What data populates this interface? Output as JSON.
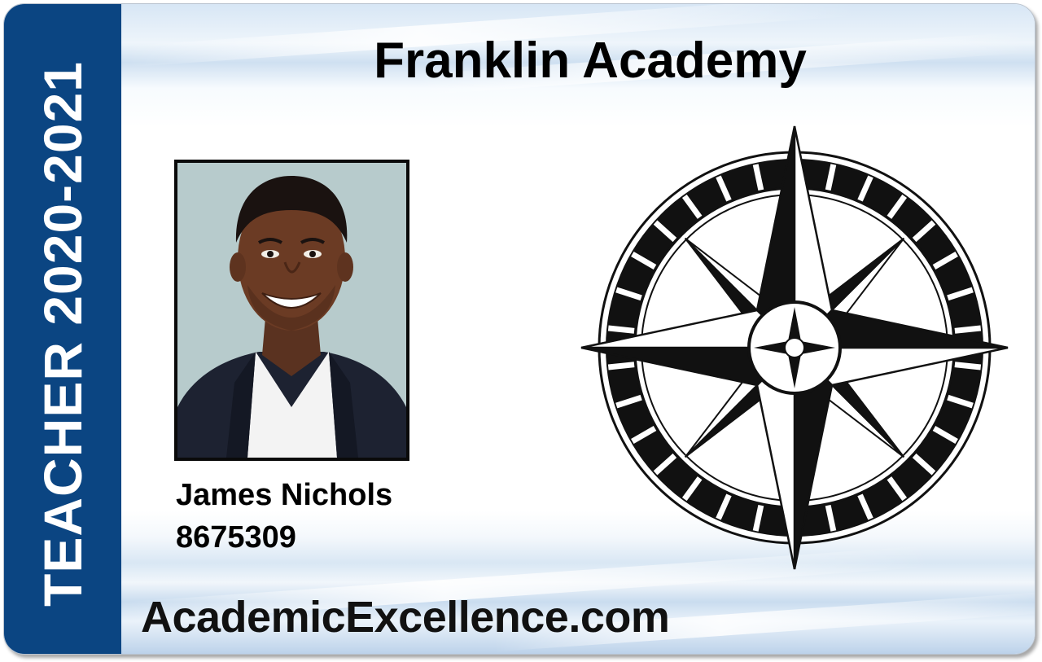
{
  "card": {
    "role_year": "TEACHER 2020-2021",
    "school_name": "Franklin Academy",
    "person_name": "James Nichols",
    "person_id": "8675309",
    "website": "AcademicExcellence.com"
  },
  "colors": {
    "sidebar": "#0b4582",
    "text": "#000000",
    "photo_background": "#b7cbcc"
  },
  "icons": {
    "emblem": "compass-rose-icon",
    "photo": "portrait-photo"
  }
}
